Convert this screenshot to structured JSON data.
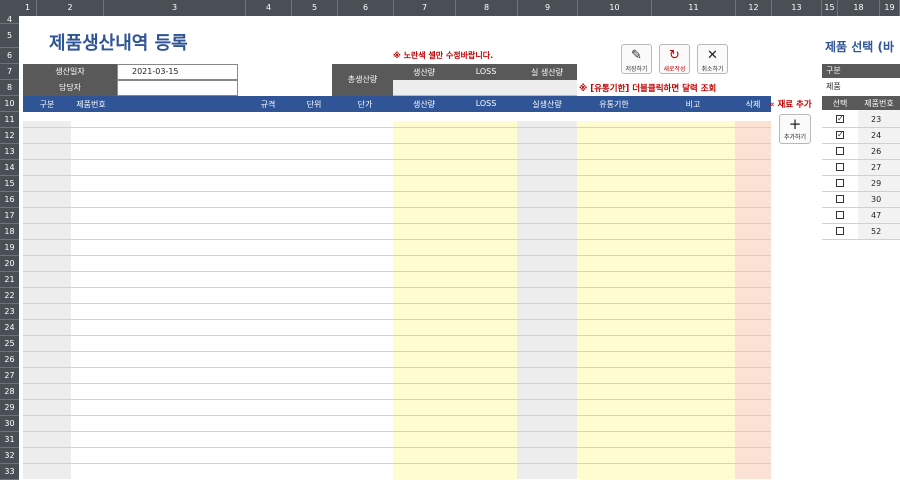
{
  "column_headers": [
    "1",
    "2",
    "3",
    "4",
    "5",
    "6",
    "7",
    "8",
    "9",
    "10",
    "11",
    "12",
    "13",
    "15",
    "18",
    "19"
  ],
  "row_headers": [
    "4",
    "5",
    "6",
    "7",
    "8",
    "10",
    "11",
    "12",
    "13",
    "14",
    "15",
    "16",
    "17",
    "18",
    "19",
    "20",
    "21",
    "22",
    "23",
    "24",
    "25",
    "26",
    "27",
    "28",
    "29",
    "30",
    "31",
    "32",
    "33"
  ],
  "page_title": "제품생산내역 등록",
  "notice_yellow": "※ 노란색 셀만 수정바랍니다.",
  "notice_expiry": "※ [유통기한] 더블클릭하면 달력 조회",
  "info": {
    "date_label": "생산일자",
    "date_value": "2021-03-15",
    "manager_label": "담당자",
    "manager_value": ""
  },
  "totals": {
    "label": "총생산량",
    "col_production": "생산량",
    "col_loss": "LOSS",
    "col_actual": "실 생산량"
  },
  "toolbar": {
    "save": "저장하기",
    "new": "새로작성",
    "cancel": "취소하기"
  },
  "table_headers": [
    "구분",
    "제품번호",
    "규격",
    "단위",
    "단가",
    "생산량",
    "LOSS",
    "실생산량",
    "유통기한",
    "비고",
    "삭제"
  ],
  "add_material": {
    "label": "« 재료 추가",
    "button": "추가하기"
  },
  "product_panel": {
    "title": "제품 선택 (바",
    "category_label": "구분",
    "category_value": "제품",
    "col_select": "선택",
    "col_number": "제품번호",
    "items": [
      {
        "checked": true,
        "number": "23"
      },
      {
        "checked": true,
        "number": "24"
      },
      {
        "checked": false,
        "number": "26"
      },
      {
        "checked": false,
        "number": "27"
      },
      {
        "checked": false,
        "number": "29"
      },
      {
        "checked": false,
        "number": "30"
      },
      {
        "checked": false,
        "number": "47"
      },
      {
        "checked": false,
        "number": "52"
      }
    ]
  },
  "colors": {
    "header_blue": "#2f5597",
    "dark_gray": "#595959",
    "yellow": "#fffccf",
    "pink": "#fbe2d5",
    "gray_fill": "#ededed",
    "title_blue": "#2f5597",
    "red": "#c00000"
  }
}
